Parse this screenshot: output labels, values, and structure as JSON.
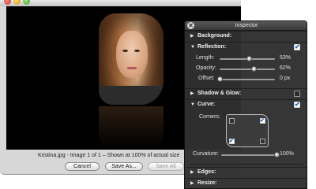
{
  "main_window": {
    "status_text": "Kristina.jpg - Image 1 of 1 – Shown at 100% of actual size",
    "buttons": {
      "cancel": "Cancel",
      "save_as": "Save As...",
      "save_all": "Save All"
    }
  },
  "inspector": {
    "title": "Inspector",
    "close_glyph": "✕",
    "sections": {
      "background": {
        "label": "Background:",
        "expanded": false
      },
      "reflection": {
        "label": "Reflection:",
        "expanded": true,
        "checked": true
      },
      "shadow_glow": {
        "label": "Shadow & Glow:",
        "expanded": false,
        "checked": false
      },
      "curve": {
        "label": "Curve:",
        "expanded": true,
        "checked": true
      },
      "edges": {
        "label": "Edges:",
        "expanded": false
      },
      "resize": {
        "label": "Resize:",
        "expanded": false
      }
    },
    "reflection": {
      "length": {
        "label": "Length:",
        "value": "53%",
        "fraction": 0.53
      },
      "opacity": {
        "label": "Opacity:",
        "value": "62%",
        "fraction": 0.62
      },
      "offset": {
        "label": "Offset:",
        "value": "0 px",
        "fraction": 0.0
      }
    },
    "curve": {
      "corners_label": "Corners:",
      "corners": {
        "top_left": false,
        "top_right": true,
        "bottom_left": true,
        "bottom_right": false
      },
      "curvature": {
        "label": "Curvature:",
        "value": "100%",
        "fraction": 1.0
      }
    },
    "glyphs": {
      "collapsed": "▶",
      "expanded": "▼",
      "check": "✔"
    }
  },
  "colors": {
    "panel": "#303030",
    "accent_check": "#1b5fbf"
  }
}
